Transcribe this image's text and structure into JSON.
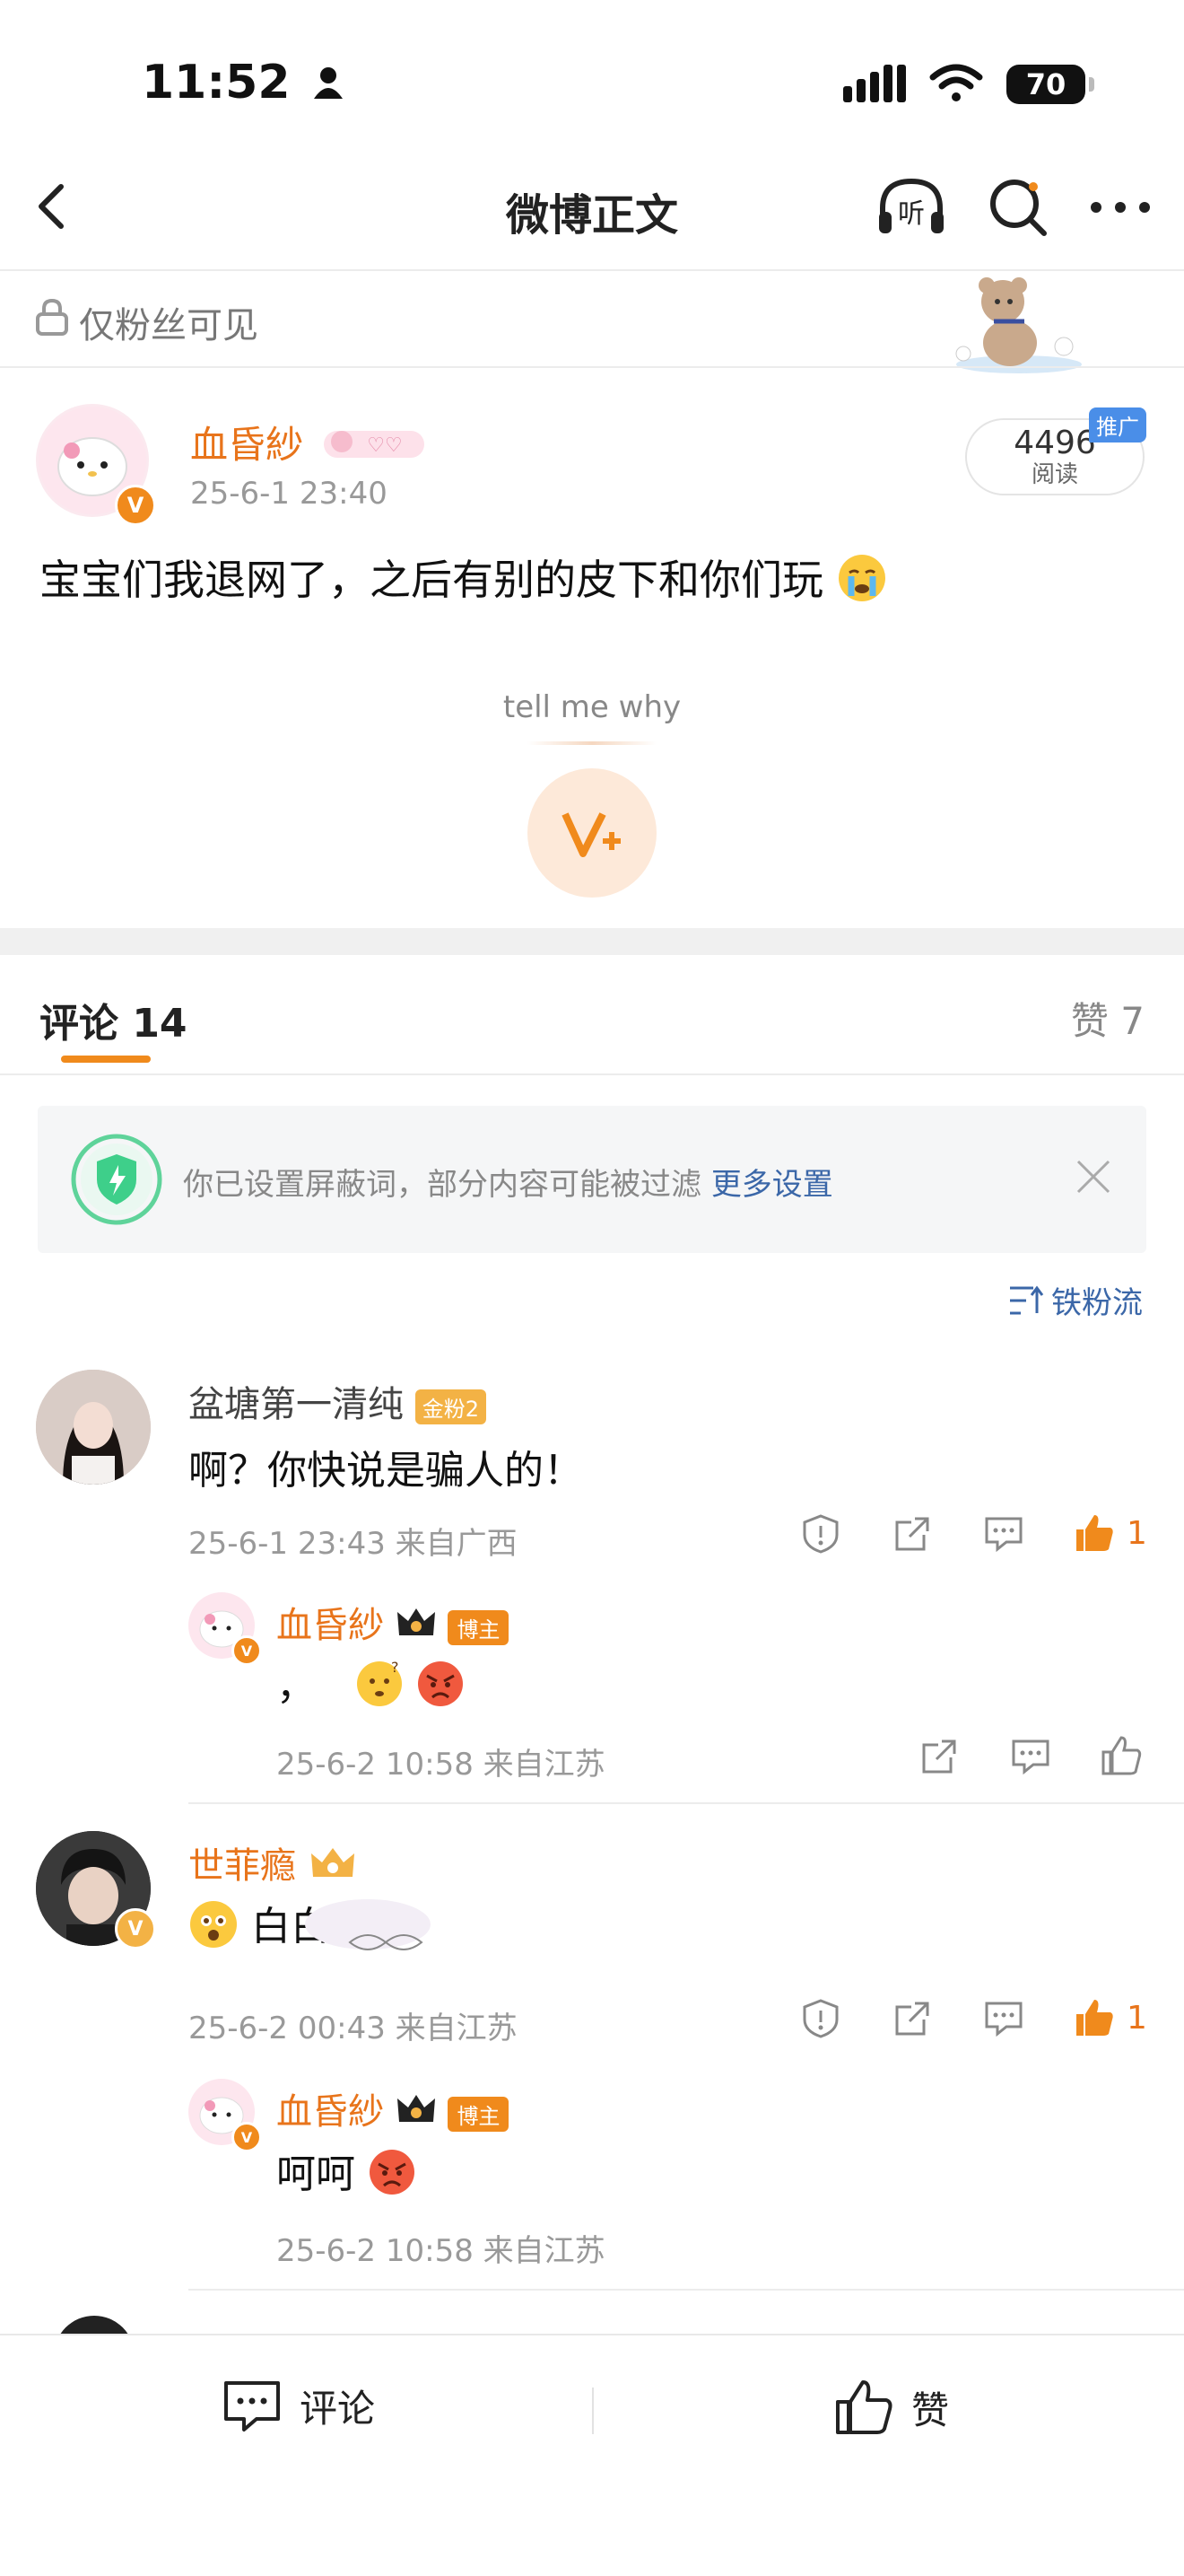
{
  "status": {
    "time": "11:52",
    "battery": "70"
  },
  "nav": {
    "title": "微博正文"
  },
  "visibility": {
    "label": "仅粉丝可见"
  },
  "post": {
    "author": "血昏紗",
    "time": "25-6-1 23:40",
    "read_count": "4496",
    "read_label": "阅读",
    "promo_badge": "推广",
    "text": "宝宝们我退网了，之后有别的皮下和你们玩",
    "reaction_prompt": "tell me why"
  },
  "tabs": {
    "comments": "评论 14",
    "likes": "赞 7"
  },
  "filter_notice": {
    "text": "你已设置屏蔽词，部分内容可能被过滤",
    "link": "更多设置"
  },
  "sort": {
    "label": "铁粉流"
  },
  "comments": [
    {
      "name": "盆塘第一清纯",
      "badge": "金粉2",
      "text": "啊？你快说是骗人的！",
      "meta": "25-6-1 23:43  来自广西",
      "likes": "1",
      "reply": {
        "name": "血昏紗",
        "badge": "博主",
        "text": "，",
        "meta": "25-6-2 10:58  来自江苏"
      }
    },
    {
      "name": "世菲瘾",
      "text": "白白",
      "meta": "25-6-2 00:43  来自江苏",
      "likes": "1",
      "reply": {
        "name": "血昏紗",
        "badge": "博主",
        "text": "呵呵",
        "meta": "25-6-2 10:58  来自江苏"
      }
    }
  ],
  "bottom": {
    "comment": "评论",
    "like": "赞"
  },
  "colors": {
    "accent": "#f08a1c",
    "name": "#e8741b",
    "link": "#3b67a8"
  }
}
